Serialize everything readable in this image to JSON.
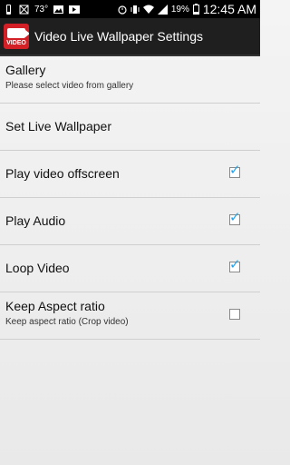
{
  "statusbar": {
    "temp": "73°",
    "battery": "19%",
    "time": "12:45 AM",
    "icons_left": [
      "phone-icon",
      "no-sim-icon",
      "image-icon",
      "video-icon"
    ],
    "icons_right": [
      "alarm-icon",
      "vibrate-icon",
      "wifi-icon",
      "signal-icon",
      "battery-icon"
    ]
  },
  "actionbar": {
    "app_icon_text": "VIDEO",
    "title": "Video Live Wallpaper Settings"
  },
  "settings": {
    "gallery": {
      "title": "Gallery",
      "summary": "Please select video from gallery"
    },
    "set_wallpaper": {
      "title": "Set Live Wallpaper"
    },
    "play_offscreen": {
      "title": "Play video offscreen",
      "checked": true
    },
    "play_audio": {
      "title": "Play Audio",
      "checked": true
    },
    "loop_video": {
      "title": "Loop Video",
      "checked": true
    },
    "keep_aspect": {
      "title": "Keep Aspect ratio",
      "summary": "Keep aspect ratio (Crop video)",
      "checked": false
    }
  },
  "colors": {
    "accent": "#2aa2e8",
    "actionbar": "#1f1f1f",
    "app_icon": "#d32027"
  }
}
